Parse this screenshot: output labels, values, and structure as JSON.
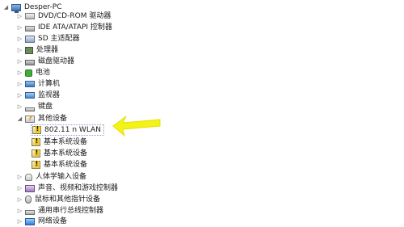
{
  "device_manager": {
    "root": "Desper-PC",
    "items": [
      {
        "label": "DVD/CD-ROM 驱动器",
        "expander": "▷",
        "icon": "disk-drive-icon"
      },
      {
        "label": "IDE ATA/ATAPI 控制器",
        "expander": "▷",
        "icon": "ide-controller-icon"
      },
      {
        "label": "SD 主适配器",
        "expander": "▷",
        "icon": "sd-adapter-icon"
      },
      {
        "label": "处理器",
        "expander": "▷",
        "icon": "processor-icon"
      },
      {
        "label": "磁盘驱动器",
        "expander": "▷",
        "icon": "disk-icon"
      },
      {
        "label": "电池",
        "expander": "▷",
        "icon": "battery-icon"
      },
      {
        "label": "计算机",
        "expander": "▷",
        "icon": "computer-icon"
      },
      {
        "label": "监视器",
        "expander": "▷",
        "icon": "monitor-icon"
      },
      {
        "label": "键盘",
        "expander": "▷",
        "icon": "keyboard-icon"
      },
      {
        "label": "其他设备",
        "expander": "◢",
        "icon": "other-devices-icon"
      },
      {
        "label": "802.11 n WLAN",
        "child": true,
        "selected": true,
        "icon": "warning-device-icon"
      },
      {
        "label": "基本系统设备",
        "child": true,
        "icon": "warning-device-icon"
      },
      {
        "label": "基本系统设备",
        "child": true,
        "icon": "warning-device-icon"
      },
      {
        "label": "基本系统设备",
        "child": true,
        "icon": "warning-device-icon"
      },
      {
        "label": "人体学输入设备",
        "expander": "▷",
        "icon": "hid-icon"
      },
      {
        "label": "声音、视频和游戏控制器",
        "expander": "▷",
        "icon": "sound-icon"
      },
      {
        "label": "鼠标和其他指针设备",
        "expander": "▷",
        "icon": "mouse-icon"
      },
      {
        "label": "通用串行总线控制器",
        "expander": "▷",
        "icon": "usb-icon"
      },
      {
        "label": "网络设备",
        "expander": "▷",
        "icon": "network-icon"
      }
    ]
  },
  "annotation": {
    "arrow_color": "#f3f31a"
  }
}
